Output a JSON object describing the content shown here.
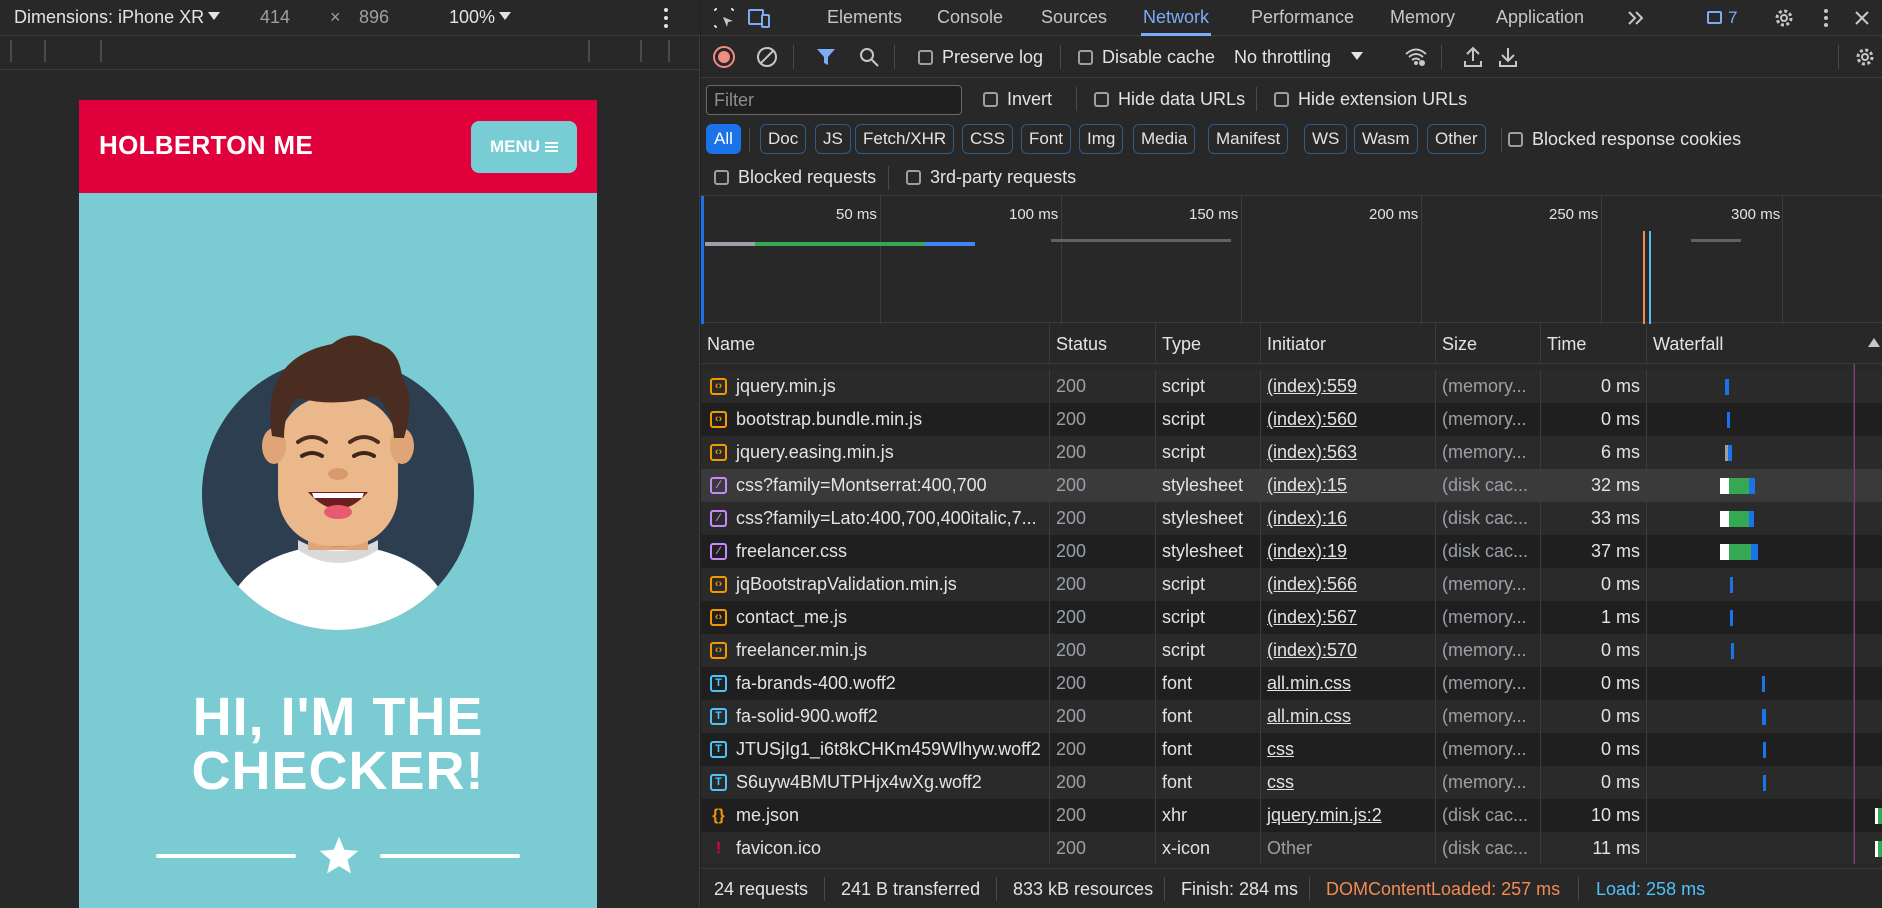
{
  "device_toolbar": {
    "dimensions_label": "Dimensions: iPhone XR",
    "width": "414",
    "times": "×",
    "height": "896",
    "zoom": "100%"
  },
  "site": {
    "brand": "HOLBERTON ME",
    "menu_label": "MENU",
    "hero_line1": "HI, I'M THE",
    "hero_line2": "CHECKER!"
  },
  "devtools": {
    "tabs": [
      "Elements",
      "Console",
      "Sources",
      "Network",
      "Performance",
      "Memory",
      "Application"
    ],
    "active_tab": "Network",
    "issues_count": "7",
    "accent_color": "#7cacf8"
  },
  "network_toolbar": {
    "preserve_log": "Preserve log",
    "disable_cache": "Disable cache",
    "throttling": "No throttling"
  },
  "filter_row": {
    "filter_placeholder": "Filter",
    "invert": "Invert",
    "hide_data_urls": "Hide data URLs",
    "hide_extension_urls": "Hide extension URLs"
  },
  "type_filters": [
    "All",
    "Doc",
    "JS",
    "Fetch/XHR",
    "CSS",
    "Font",
    "Img",
    "Media",
    "Manifest",
    "WS",
    "Wasm",
    "Other"
  ],
  "blocked_response_cookies": "Blocked response cookies",
  "blocked_requests": "Blocked requests",
  "third_party_requests": "3rd-party requests",
  "overview_ticks": [
    "50 ms",
    "100 ms",
    "150 ms",
    "200 ms",
    "250 ms",
    "300 ms"
  ],
  "columns": {
    "name": "Name",
    "status": "Status",
    "type": "Type",
    "initiator": "Initiator",
    "size": "Size",
    "time": "Time",
    "waterfall": "Waterfall"
  },
  "requests": [
    {
      "name": "jquery.min.js",
      "status": "200",
      "type": "script",
      "initiator": "(index):559",
      "size": "(memory...",
      "time": "0 ms",
      "icon": "script-icon"
    },
    {
      "name": "bootstrap.bundle.min.js",
      "status": "200",
      "type": "script",
      "initiator": "(index):560",
      "size": "(memory...",
      "time": "0 ms",
      "icon": "script-icon"
    },
    {
      "name": "jquery.easing.min.js",
      "status": "200",
      "type": "script",
      "initiator": "(index):563",
      "size": "(memory...",
      "time": "6 ms",
      "icon": "script-icon"
    },
    {
      "name": "css?family=Montserrat:400,700",
      "status": "200",
      "type": "stylesheet",
      "initiator": "(index):15",
      "size": "(disk cac...",
      "time": "32 ms",
      "icon": "stylesheet-icon"
    },
    {
      "name": "css?family=Lato:400,700,400italic,7...",
      "status": "200",
      "type": "stylesheet",
      "initiator": "(index):16",
      "size": "(disk cac...",
      "time": "33 ms",
      "icon": "stylesheet-icon"
    },
    {
      "name": "freelancer.css",
      "status": "200",
      "type": "stylesheet",
      "initiator": "(index):19",
      "size": "(disk cac...",
      "time": "37 ms",
      "icon": "stylesheet-icon"
    },
    {
      "name": "jqBootstrapValidation.min.js",
      "status": "200",
      "type": "script",
      "initiator": "(index):566",
      "size": "(memory...",
      "time": "0 ms",
      "icon": "script-icon"
    },
    {
      "name": "contact_me.js",
      "status": "200",
      "type": "script",
      "initiator": "(index):567",
      "size": "(memory...",
      "time": "1 ms",
      "icon": "script-icon"
    },
    {
      "name": "freelancer.min.js",
      "status": "200",
      "type": "script",
      "initiator": "(index):570",
      "size": "(memory...",
      "time": "0 ms",
      "icon": "script-icon"
    },
    {
      "name": "fa-brands-400.woff2",
      "status": "200",
      "type": "font",
      "initiator": "all.min.css",
      "size": "(memory...",
      "time": "0 ms",
      "icon": "font-icon"
    },
    {
      "name": "fa-solid-900.woff2",
      "status": "200",
      "type": "font",
      "initiator": "all.min.css",
      "size": "(memory...",
      "time": "0 ms",
      "icon": "font-icon"
    },
    {
      "name": "JTUSjIg1_i6t8kCHKm459Wlhyw.woff2",
      "status": "200",
      "type": "font",
      "initiator": "css",
      "size": "(memory...",
      "time": "0 ms",
      "icon": "font-icon"
    },
    {
      "name": "S6uyw4BMUTPHjx4wXg.woff2",
      "status": "200",
      "type": "font",
      "initiator": "css",
      "size": "(memory...",
      "time": "0 ms",
      "icon": "font-icon"
    },
    {
      "name": "me.json",
      "status": "200",
      "type": "xhr",
      "initiator": "jquery.min.js:2",
      "size": "(disk cac...",
      "time": "10 ms",
      "icon": "xhr-icon"
    },
    {
      "name": "favicon.ico",
      "status": "200",
      "type": "x-icon",
      "initiator": "Other",
      "size": "(disk cac...",
      "time": "11 ms",
      "icon": "favicon-icon"
    }
  ],
  "status_bar": {
    "requests": "24 requests",
    "transferred": "241 B transferred",
    "resources": "833 kB resources",
    "finish": "Finish: 284 ms",
    "dom_content_loaded": "DOMContentLoaded: 257 ms",
    "load": "Load: 258 ms",
    "dcl_color": "#f28b54",
    "load_color": "#4fc3f7"
  }
}
